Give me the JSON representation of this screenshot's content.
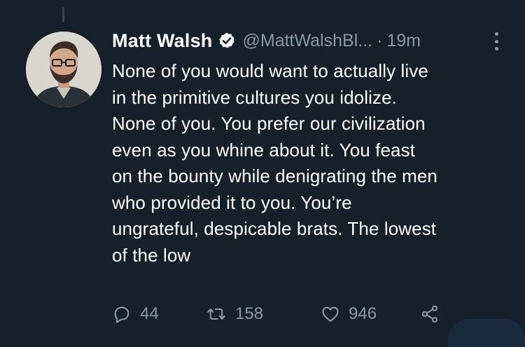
{
  "author": {
    "display_name": "Matt Walsh",
    "handle": "@MattWalshBl...",
    "separator": "·",
    "time": "19m",
    "verified": true
  },
  "tweet": {
    "text": "None of you would want to actually live\nin the primitive cultures you idolize.\nNone of you. You prefer our civilization\neven as you whine about it. You feast\non the bounty while denigrating the men\nwho provided it to you. You’re\nungrateful, despicable brats. The lowest\nof the low"
  },
  "actions": {
    "reply_count": "44",
    "retweet_count": "158",
    "like_count": "946"
  },
  "colors": {
    "background": "#15202b",
    "text": "#ffffff",
    "secondary": "#8899a6",
    "verified_badge": "#ffffff"
  },
  "icons": [
    "verified-icon",
    "more-icon",
    "reply-icon",
    "retweet-icon",
    "like-icon",
    "share-icon"
  ]
}
